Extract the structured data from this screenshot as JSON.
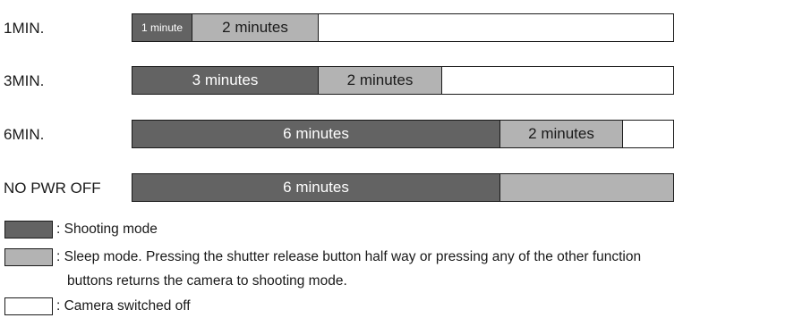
{
  "rows": [
    {
      "label": "1MIN.",
      "segments": [
        {
          "mode": "shooting",
          "text": "1 minute"
        },
        {
          "mode": "sleep",
          "text": "2 minutes"
        },
        {
          "mode": "off",
          "text": ""
        }
      ]
    },
    {
      "label": "3MIN.",
      "segments": [
        {
          "mode": "shooting",
          "text": "3 minutes"
        },
        {
          "mode": "sleep",
          "text": "2 minutes"
        },
        {
          "mode": "off",
          "text": ""
        }
      ]
    },
    {
      "label": "6MIN.",
      "segments": [
        {
          "mode": "shooting",
          "text": "6 minutes"
        },
        {
          "mode": "sleep",
          "text": "2 minutes"
        },
        {
          "mode": "off",
          "text": ""
        }
      ]
    },
    {
      "label": "NO PWR OFF",
      "segments": [
        {
          "mode": "shooting",
          "text": "6 minutes"
        },
        {
          "mode": "sleep",
          "text": ""
        }
      ]
    }
  ],
  "legend": {
    "shooting": ": Shooting mode",
    "sleep_line1": ": Sleep mode. Pressing the shutter release button half way or pressing any of the other function",
    "sleep_line2": "buttons returns the camera to shooting mode.",
    "off": ": Camera switched off"
  },
  "colors": {
    "shooting": "#636363",
    "sleep": "#b3b3b3",
    "off": "#ffffff",
    "outline": "#1a1a1a"
  }
}
